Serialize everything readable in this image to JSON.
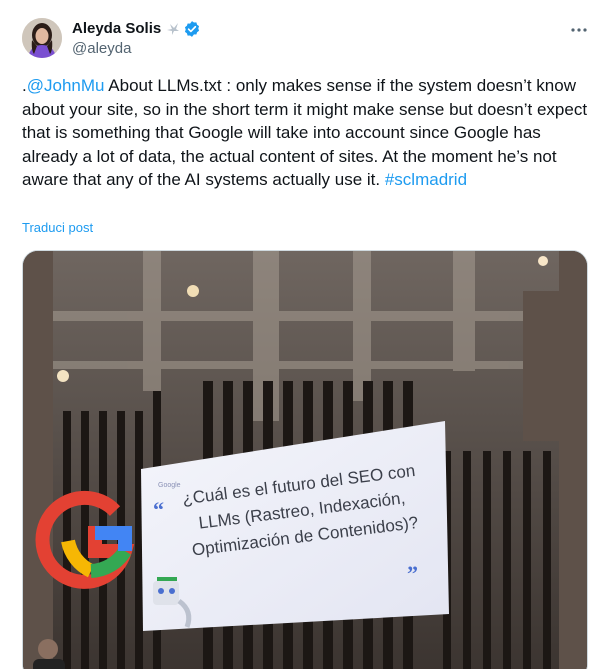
{
  "author": {
    "display_name": "Aleyda Solis",
    "name_emoji_icon": "bird-emoji-icon",
    "verified_icon": "verified-badge-icon",
    "handle": "@aleyda"
  },
  "tweet": {
    "prefix": ".",
    "mention": "@JohnMu",
    "body": " About LLMs.txt : only makes sense if the system doesn’t know about your site, so in the short term it might make sense but doesn’t expect that is something that Google will take into account since Google has already a lot of data, the actual content of sites. At the moment he’s not aware that any of the AI systems actually use it. ",
    "hashtag": "#sclmadrid",
    "translate_label": "Traduci post"
  },
  "photo": {
    "screen_brand": "Google",
    "open_quote": "“",
    "screen_text": "¿Cuál es el futuro del SEO con LLMs (Rastreo, Indexación, Optimización de Contenidos)?",
    "close_quote": "”"
  },
  "colors": {
    "link": "#1d9bf0",
    "verified": "#1d9bf0",
    "text": "#0f1419",
    "secondary": "#536471"
  }
}
